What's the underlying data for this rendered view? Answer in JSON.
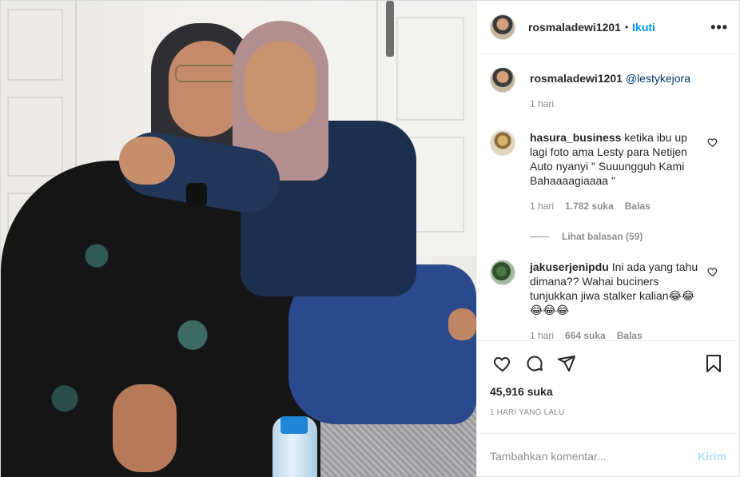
{
  "post": {
    "author": "rosmaladewi1201",
    "dot": "•",
    "follow_label": "Ikuti",
    "more_label": "•••"
  },
  "caption": {
    "username": "rosmaladewi1201",
    "mention": "@lestykejora",
    "time": "1 hari"
  },
  "comments": [
    {
      "username": "hasura_business",
      "text": "ketika ibu up lagi foto ama Lesty para Netijen Auto nyanyi \" Suuungguh Kami Bahaaaagiaaaa \"",
      "time": "1 hari",
      "likes": "1.782 suka",
      "reply_label": "Balas",
      "view_replies": "Lihat balasan (59)"
    },
    {
      "username": "jakuserjenipdu",
      "text": "Ini ada yang tahu dimana?? Wahai buciners tunjukkan jiwa stalker kalian😂😂😂😂😂",
      "time": "1 hari",
      "likes": "664 suka",
      "reply_label": "Balas"
    }
  ],
  "footer": {
    "likes": "45,916 suka",
    "posted": "1 HARI YANG LALU",
    "comment_placeholder": "Tambahkan komentar...",
    "post_label": "Kirim"
  },
  "icons": {
    "like": "heart-icon",
    "comment": "comment-icon",
    "share": "share-icon",
    "save": "bookmark-icon"
  },
  "colors": {
    "accent": "#0095f6",
    "muted": "#8e8e8e",
    "text": "#262626",
    "disabled_accent": "#b2dffc"
  }
}
